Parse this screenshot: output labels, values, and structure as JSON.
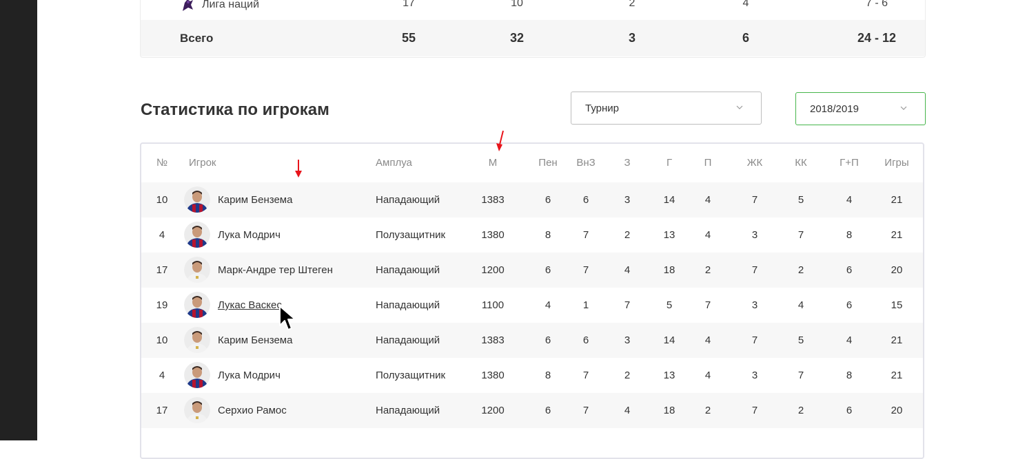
{
  "team_stats": {
    "league_row": {
      "name": "Лига наций",
      "v1": "17",
      "v2": "10",
      "v3": "2",
      "v4": "4",
      "score": "7 - 6",
      "icon": "league-icon"
    },
    "total_row": {
      "name": "Всего",
      "v1": "55",
      "v2": "32",
      "v3": "3",
      "v4": "6",
      "score": "24 - 12"
    }
  },
  "players_section": {
    "title": "Статистика по игрокам",
    "tournament_select": {
      "value": "Турнир"
    },
    "season_select": {
      "value": "2018/2019"
    }
  },
  "player_table": {
    "headers": [
      "№",
      "Игрок",
      "Амплуа",
      "М",
      "Пен",
      "ВнЗ",
      "З",
      "Г",
      "П",
      "ЖК",
      "КК",
      "Г+П",
      "Игры"
    ],
    "rows": [
      {
        "num": "10",
        "name": "Карим Бензема",
        "role": "Нападающий",
        "m": "1383",
        "pen": "6",
        "vnz": "6",
        "z": "3",
        "g": "14",
        "p": "4",
        "zhk": "7",
        "kk": "5",
        "gp": "4",
        "games": "21",
        "kit": "barca"
      },
      {
        "num": "4",
        "name": "Лука Модрич",
        "role": "Полузащитник",
        "m": "1380",
        "pen": "8",
        "vnz": "7",
        "z": "2",
        "g": "13",
        "p": "4",
        "zhk": "3",
        "kk": "7",
        "gp": "8",
        "games": "21",
        "kit": "barca"
      },
      {
        "num": "17",
        "name": "Марк-Андре тер Штеген",
        "role": "Нападающий",
        "m": "1200",
        "pen": "6",
        "vnz": "7",
        "z": "4",
        "g": "18",
        "p": "2",
        "zhk": "7",
        "kk": "2",
        "gp": "6",
        "games": "20",
        "kit": "real"
      },
      {
        "num": "19",
        "name": "Лукас Васкес",
        "role": "Нападающий",
        "m": "1100",
        "pen": "4",
        "vnz": "1",
        "z": "7",
        "g": "5",
        "p": "7",
        "zhk": "3",
        "kk": "4",
        "gp": "6",
        "games": "15",
        "kit": "barca",
        "hovered": true
      },
      {
        "num": "10",
        "name": "Карим Бензема",
        "role": "Нападающий",
        "m": "1383",
        "pen": "6",
        "vnz": "6",
        "z": "3",
        "g": "14",
        "p": "4",
        "zhk": "7",
        "kk": "5",
        "gp": "4",
        "games": "21",
        "kit": "real"
      },
      {
        "num": "4",
        "name": "Лука Модрич",
        "role": "Полузащитник",
        "m": "1380",
        "pen": "8",
        "vnz": "7",
        "z": "2",
        "g": "13",
        "p": "4",
        "zhk": "3",
        "kk": "7",
        "gp": "8",
        "games": "21",
        "kit": "barca"
      },
      {
        "num": "17",
        "name": "Серхио Рамос",
        "role": "Нападающий",
        "m": "1200",
        "pen": "6",
        "vnz": "7",
        "z": "4",
        "g": "18",
        "p": "2",
        "zhk": "7",
        "kk": "2",
        "gp": "6",
        "games": "20",
        "kit": "real"
      }
    ]
  },
  "colors": {
    "accent": "#3ba845",
    "annotation": "#e8141b",
    "barca_blue": "#1f3a8a",
    "barca_red": "#b5142f"
  }
}
